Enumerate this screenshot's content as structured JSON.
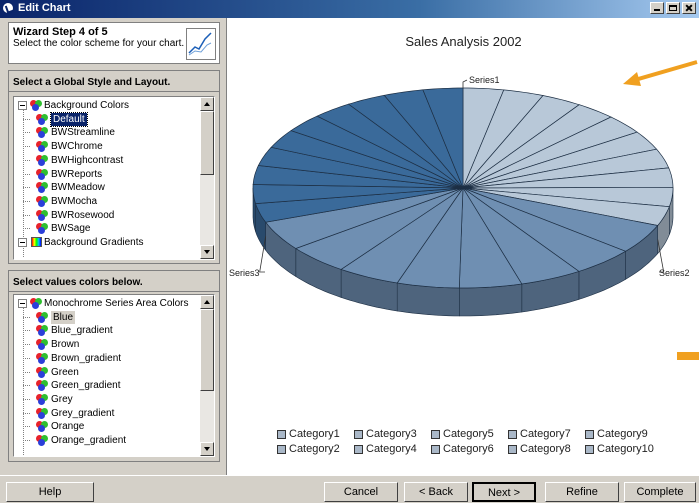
{
  "window": {
    "title": "Edit Chart"
  },
  "header": {
    "step": "Wizard Step 4 of 5",
    "subtitle": "Select the color scheme for your chart."
  },
  "style_box": {
    "title": "Select a Global Style and Layout.",
    "items": [
      {
        "label": "Background Colors",
        "type": "group",
        "expanded": true
      },
      {
        "label": "Default",
        "selected": true
      },
      {
        "label": "BWStreamline"
      },
      {
        "label": "BWChrome"
      },
      {
        "label": "BWHighcontrast"
      },
      {
        "label": "BWReports"
      },
      {
        "label": "BWMeadow"
      },
      {
        "label": "BWMocha"
      },
      {
        "label": "BWRosewood"
      },
      {
        "label": "BWSage"
      },
      {
        "label": "Background Gradients",
        "type": "group",
        "expanded": true
      }
    ]
  },
  "values_box": {
    "title": "Select values colors below.",
    "items": [
      {
        "label": "Monochrome Series Area Colors",
        "type": "group",
        "expanded": true
      },
      {
        "label": "Blue",
        "selected": true
      },
      {
        "label": "Blue_gradient"
      },
      {
        "label": "Brown"
      },
      {
        "label": "Brown_gradient"
      },
      {
        "label": "Green"
      },
      {
        "label": "Green_gradient"
      },
      {
        "label": "Grey"
      },
      {
        "label": "Grey_gradient"
      },
      {
        "label": "Orange"
      },
      {
        "label": "Orange_gradient"
      }
    ]
  },
  "chart_data": {
    "type": "pie",
    "title": "Sales Analysis 2002",
    "series_labels": [
      "Series1",
      "Series2",
      "Series3"
    ],
    "legend": {
      "placement": "bottom",
      "items": [
        "Category1",
        "Category2",
        "Category3",
        "Category4",
        "Category5",
        "Category6",
        "Category7",
        "Category8",
        "Category9",
        "Category10"
      ]
    },
    "series_colors": [
      "#b8c8d8",
      "#6f8fb2",
      "#3a6a9a"
    ]
  },
  "buttons": {
    "help": "Help",
    "cancel": "Cancel",
    "back": "< Back",
    "next": "Next >",
    "refine": "Refine",
    "complete": "Complete"
  },
  "colors": {
    "title_bar": "#0a246a",
    "arrow": "#f0a020",
    "selection": "#0a246a"
  }
}
